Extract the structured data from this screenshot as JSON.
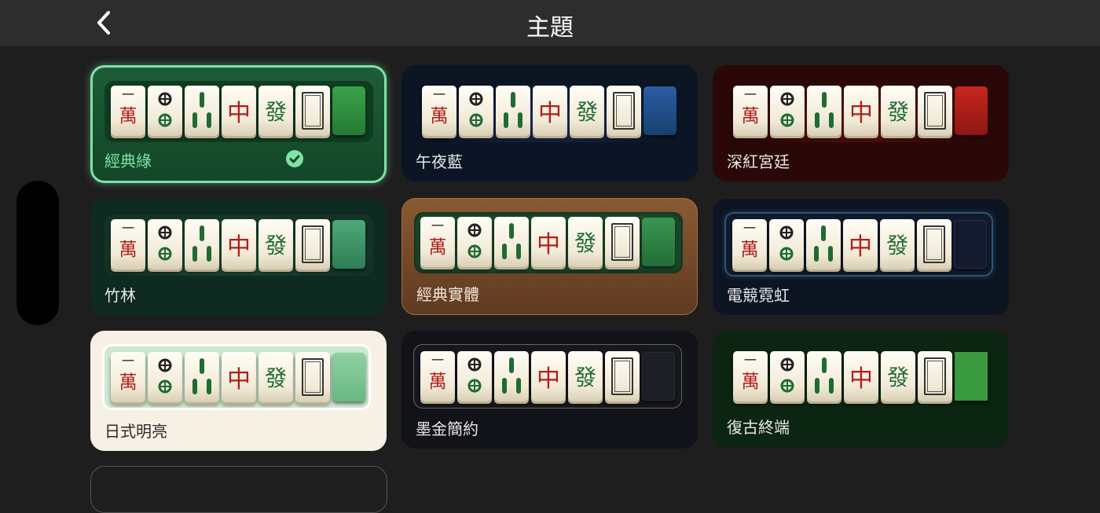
{
  "header": {
    "title": "主題"
  },
  "tiles": {
    "wan_top": "一",
    "wan_bottom": "萬",
    "zhong": "中",
    "fa": "發"
  },
  "themes": [
    {
      "name": "經典綠",
      "selected": true,
      "accent": "#2f8f3f",
      "bg": "#154a2a",
      "name_color": "#7ee3a6"
    },
    {
      "name": "午夜藍",
      "selected": false,
      "accent": "#1e4f8f",
      "bg": "#0c1524",
      "name_color": "#e8e8e8"
    },
    {
      "name": "深紅宮廷",
      "selected": false,
      "accent": "#b3231f",
      "bg": "#2a0808",
      "name_color": "#e8e8e8"
    },
    {
      "name": "竹林",
      "selected": false,
      "accent": "#3f9a6b",
      "bg": "#0f2a20",
      "name_color": "#e8e8e8"
    },
    {
      "name": "經典實體",
      "selected": false,
      "accent": "#2f8a45",
      "bg": "#6b4326",
      "name_color": "#f2e6d8"
    },
    {
      "name": "電競霓虹",
      "selected": false,
      "accent": "#141b2e",
      "bg": "#0d1422",
      "name_color": "#e8e8e8"
    },
    {
      "name": "日式明亮",
      "selected": false,
      "accent": "#7fc795",
      "bg": "#f6f1e4",
      "name_color": "#2a2a2a"
    },
    {
      "name": "墨金簡約",
      "selected": false,
      "accent": "#1c1f26",
      "bg": "#111318",
      "name_color": "#e8e8e8"
    },
    {
      "name": "復古終端",
      "selected": false,
      "accent": "#3a9a3f",
      "bg": "#0c2412",
      "name_color": "#e8e8e8"
    }
  ]
}
